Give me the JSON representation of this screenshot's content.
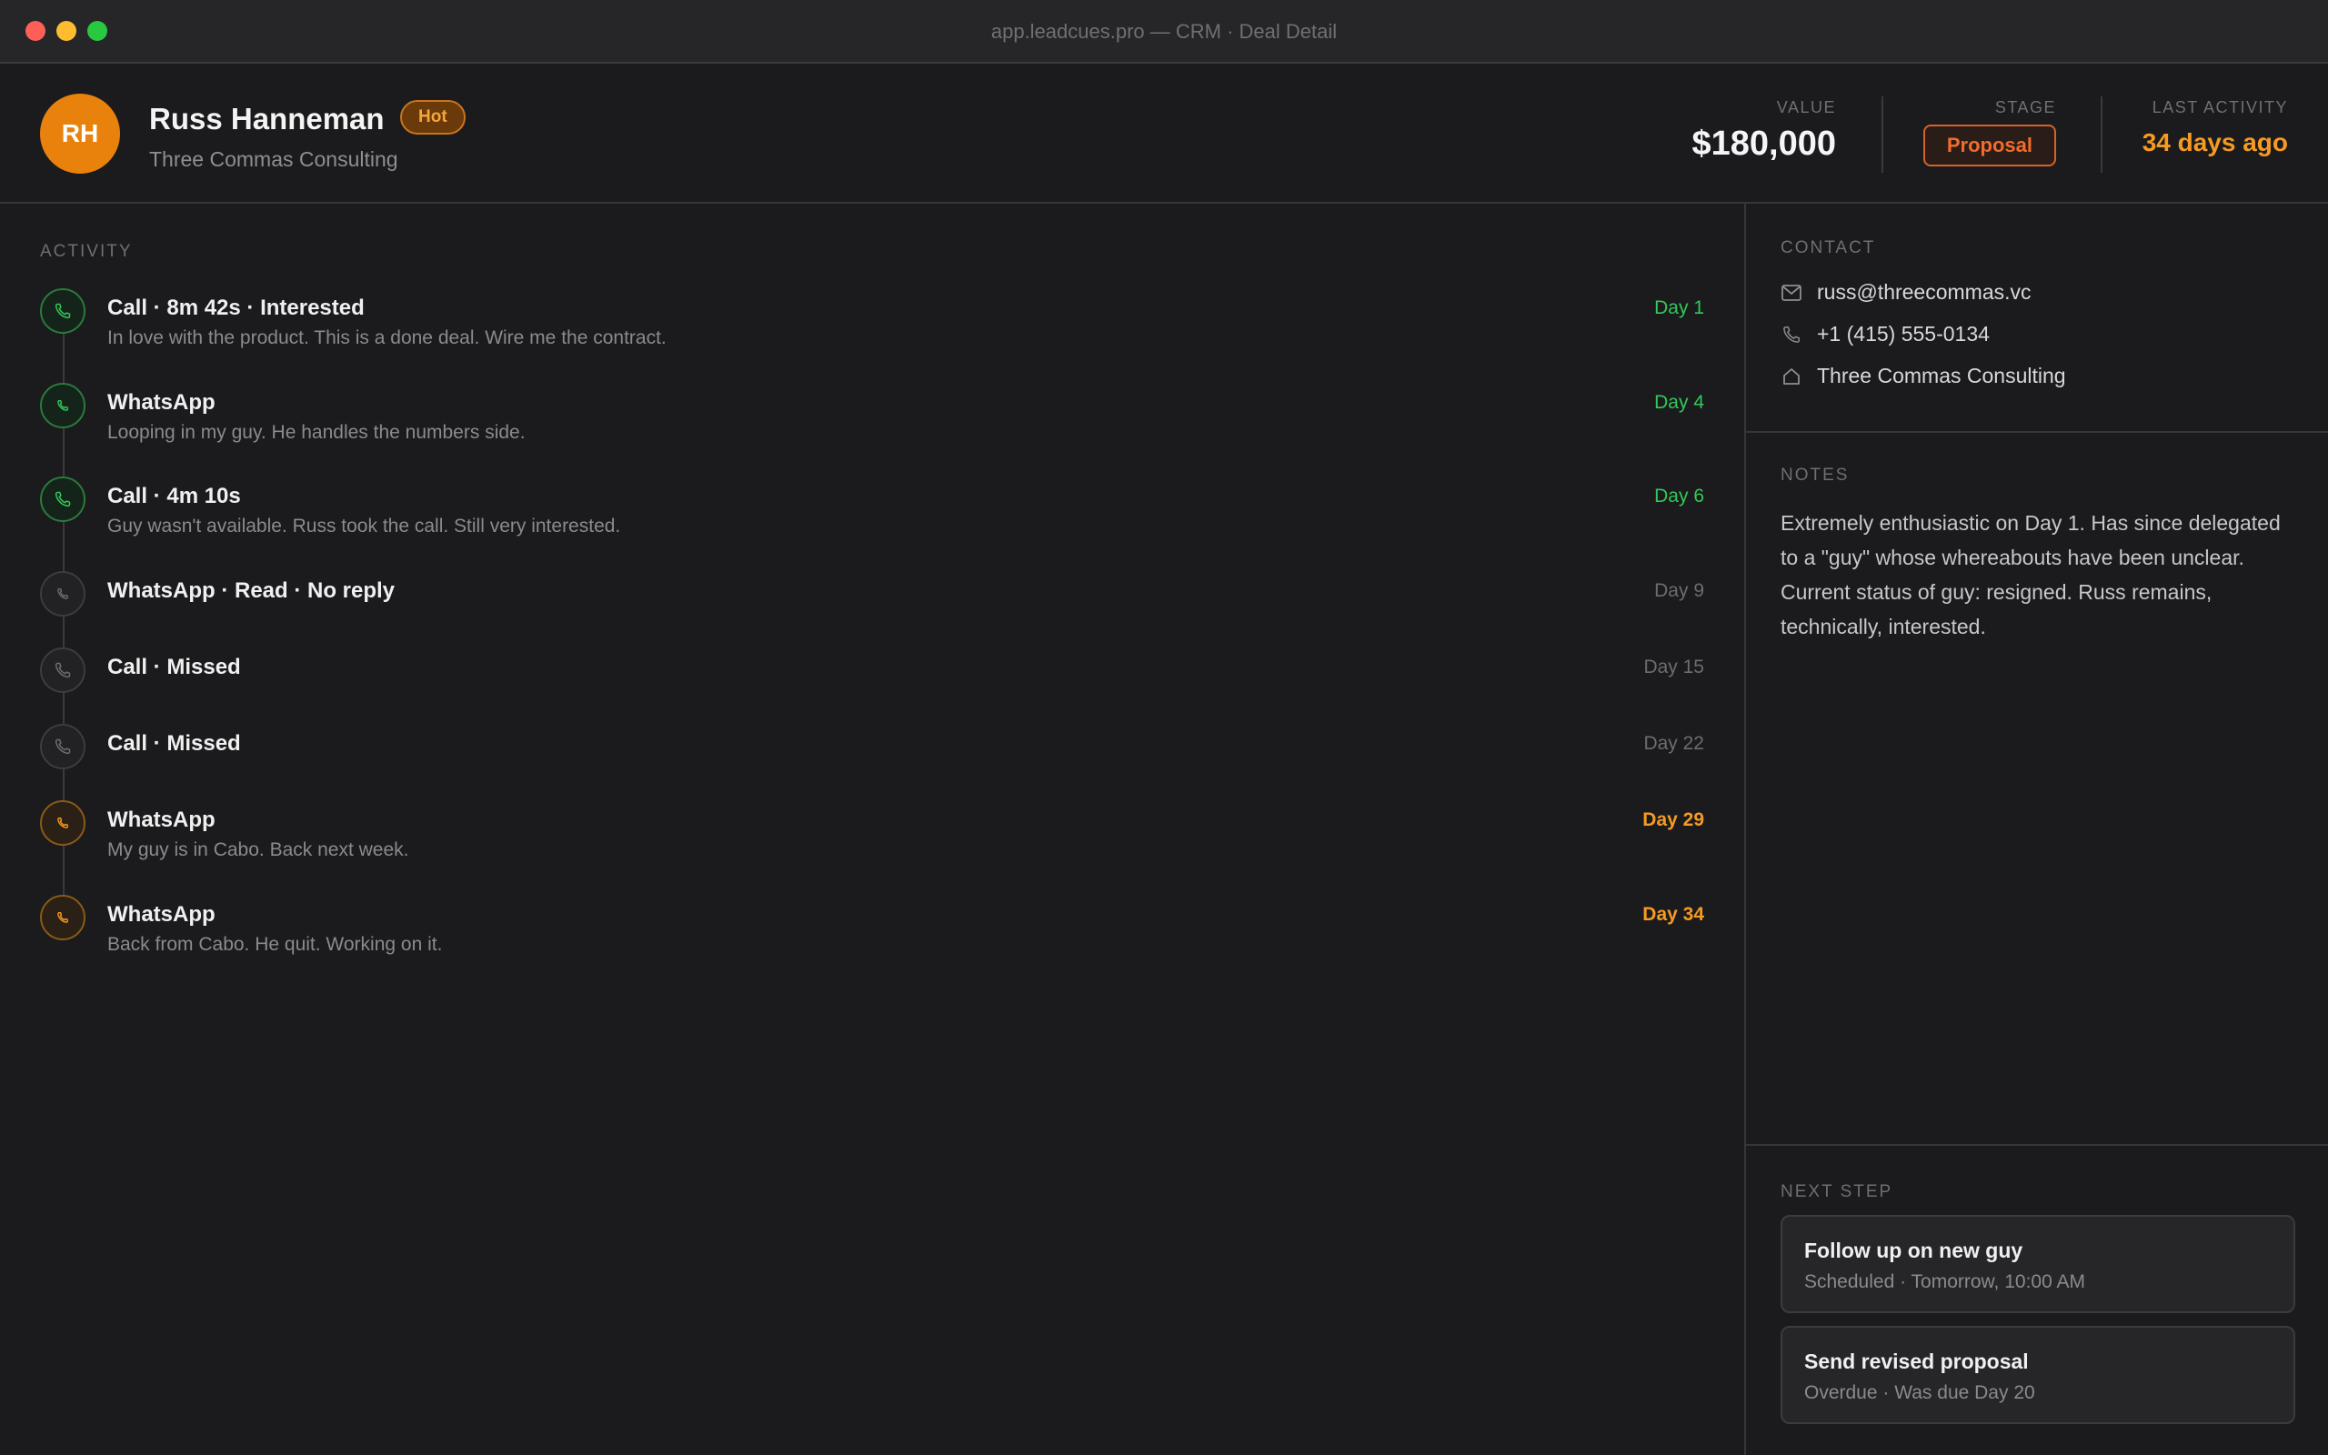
{
  "window": {
    "title": "app.leadcues.pro — CRM · Deal Detail"
  },
  "header": {
    "initials": "RH",
    "name": "Russ Hanneman",
    "badge": "Hot",
    "company": "Three Commas Consulting",
    "value_label": "VALUE",
    "value": "$180,000",
    "stage_label": "STAGE",
    "stage": "Proposal",
    "last_label": "LAST ACTIVITY",
    "last_activity": "34 days ago"
  },
  "activity": {
    "label": "ACTIVITY",
    "events": [
      {
        "title": "Call · 8m 42s · Interested",
        "desc": "In love with the product. This is a done deal. Wire me the contract.",
        "day": "Day 1",
        "tone": "green",
        "icon": "phone-icon"
      },
      {
        "title": "WhatsApp",
        "desc": "Looping in my guy. He handles the numbers side.",
        "day": "Day 4",
        "tone": "green",
        "icon": "whatsapp-icon"
      },
      {
        "title": "Call · 4m 10s",
        "desc": "Guy wasn't available. Russ took the call. Still very interested.",
        "day": "Day 6",
        "tone": "green",
        "icon": "phone-icon"
      },
      {
        "title": "WhatsApp · Read · No reply",
        "desc": "",
        "day": "Day 9",
        "tone": "gray",
        "icon": "whatsapp-icon"
      },
      {
        "title": "Call · Missed",
        "desc": "",
        "day": "Day 15",
        "tone": "gray",
        "icon": "phone-icon"
      },
      {
        "title": "Call · Missed",
        "desc": "",
        "day": "Day 22",
        "tone": "gray",
        "icon": "phone-icon"
      },
      {
        "title": "WhatsApp",
        "desc": "My guy is in Cabo. Back next week.",
        "day": "Day 29",
        "tone": "orange",
        "icon": "whatsapp-icon"
      },
      {
        "title": "WhatsApp",
        "desc": "Back from Cabo. He quit. Working on it.",
        "day": "Day 34",
        "tone": "orange",
        "icon": "whatsapp-icon"
      }
    ]
  },
  "contact": {
    "label": "CONTACT",
    "email": "russ@threecommas.vc",
    "phone": "+1 (415) 555-0134",
    "company": "Three Commas Consulting"
  },
  "notes": {
    "label": "NOTES",
    "text": "Extremely enthusiastic on Day 1. Has since delegated to a \"guy\" whose whereabouts have been unclear. Current status of guy: resigned. Russ remains, technically, interested."
  },
  "next_step": {
    "label": "NEXT STEP",
    "tasks": [
      {
        "title": "Follow up on new guy",
        "sub": "Scheduled · Tomorrow, 10:00 AM"
      },
      {
        "title": "Send revised proposal",
        "sub": "Overdue · Was due Day 20"
      }
    ]
  },
  "colors": {
    "accent_orange": "#f59a23",
    "green": "#34c759",
    "stage_orange": "#f26b2c",
    "background": "#1b1b1d"
  }
}
